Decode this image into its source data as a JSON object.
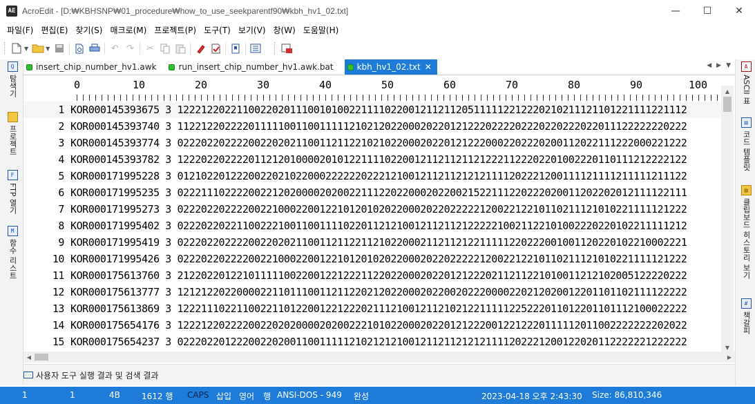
{
  "window": {
    "app_icon": "AE",
    "title": "AcroEdit - [D:₩KBHSNP₩01_procedure₩how_to_use_seekparentf90₩kbh_hv1_02.txt]",
    "minimize": "—",
    "maximize": "☐",
    "close": "✕"
  },
  "menu": [
    "파일(F)",
    "편집(E)",
    "찾기(S)",
    "매크로(M)",
    "프로젝트(P)",
    "도구(T)",
    "보기(V)",
    "창(W)",
    "도움말(H)"
  ],
  "toolbar_icons": [
    "new-file-icon",
    "open-folder-icon",
    "save-icon",
    "print-preview-icon",
    "print-icon",
    "undo-icon",
    "redo-icon",
    "cut-icon",
    "copy-icon",
    "paste-icon",
    "highlighter-icon",
    "spell-check-icon",
    "bookmark-icon",
    "column-view-icon",
    "calendar-icon"
  ],
  "left_panel": [
    {
      "label": "탐색기",
      "icon": "explorer-icon"
    },
    {
      "label": "프로젝트",
      "icon": "project-icon"
    },
    {
      "label": "FTP 열기",
      "icon": "ftp-icon"
    },
    {
      "label": "함수 리스트",
      "icon": "function-list-icon"
    }
  ],
  "right_panel": [
    {
      "label": "ASCII 표",
      "icon": "ascii-icon"
    },
    {
      "label": "코드 템플릿",
      "icon": "code-template-icon"
    },
    {
      "label": "클립보드 히스토리 보기",
      "icon": "clipboard-icon"
    },
    {
      "label": "책갈피",
      "icon": "bookmark-list-icon"
    }
  ],
  "tabs": [
    {
      "label": "insert_chip_number_hv1.awk",
      "active": false
    },
    {
      "label": "run_insert_chip_number_hv1.awk.bat",
      "active": false
    },
    {
      "label": "kbh_hv1_02.txt",
      "active": true
    }
  ],
  "ruler": [
    "0",
    "10",
    "20",
    "30",
    "40",
    "50",
    "60",
    "70",
    "80",
    "90",
    "100"
  ],
  "lines": [
    {
      "num": "1",
      "text": "KOR000145393675 3 12221220221100220201110010100221111022001211211205111112212220210211121101221111221112"
    },
    {
      "num": "2",
      "text": "KOR000145393740 3 11221220222201111100110011111210212022000202201212220222202220220222022011122222220222"
    },
    {
      "num": "3",
      "text": "KOR000145393774 3 02220220222200220202110011211221021022000202201212220002202220200112022111222000221222"
    },
    {
      "num": "4",
      "text": "KOR000145393782 3 12220220222201121201000020101221111022001211211211212221122202201002220110111212222122"
    },
    {
      "num": "5",
      "text": "KOR000171995228 3 01210220122200220210220002222220222121001211211212121111202221200111121111211111211122"
    },
    {
      "num": "6",
      "text": "KOR000171995235 3 02221110222200221202000020200221112202200020220021522111220222020011202202012111122111"
    },
    {
      "num": "7",
      "text": "KOR000171995273 3 02220220222200221000220012210120102022000202202222212002212210110211121010221111121222"
    },
    {
      "num": "8",
      "text": "KOR000171995402 3 02220220221100222100110011110220112121001211211212222210021122101002220220102211111212"
    },
    {
      "num": "9",
      "text": "KOR000171995419 3 02220220222200220202110011211221121022000211211212211111220222001001120220102210002221"
    },
    {
      "num": "10",
      "text": "KOR000171995426 3 02220220222200221000220012210120102022000202202222212002212210110211121010221111121222"
    },
    {
      "num": "11",
      "text": "KOR000175613760 3 21220220122101111100220012212221122022000202201212220211211221010011212102005122220222"
    },
    {
      "num": "12",
      "text": "KOR000175613777 3 12121220220000221101110011211220212022000202200202220000220212020012201101102111122222"
    },
    {
      "num": "13",
      "text": "KOR000175613869 3 12221110221100221101220012212220211121001211210212211111225222011012201101112100022222"
    },
    {
      "num": "14",
      "text": "KOR000175654176 3 12221220222200220202000020200222101022000202201212220012212220111112011002222222202022"
    },
    {
      "num": "15",
      "text": "KOR000175654237 3 02220220122200220200110011111210212121001211211212121111202221200122020112222221222222"
    }
  ],
  "bottom_panel": {
    "label": "사용자 도구 실행 결과 및 검색 결과"
  },
  "status": {
    "line": "1",
    "col": "1",
    "bytes": "4B",
    "total_lines": "1612 행",
    "caps": "CAPS",
    "insert": "삽입",
    "lang": "영어",
    "mode": "행",
    "encoding": "ANSI-DOS - 949",
    "state": "완성",
    "datetime": "2023-04-18 오후 2:43:30",
    "size": "Size: 86,810,346"
  }
}
